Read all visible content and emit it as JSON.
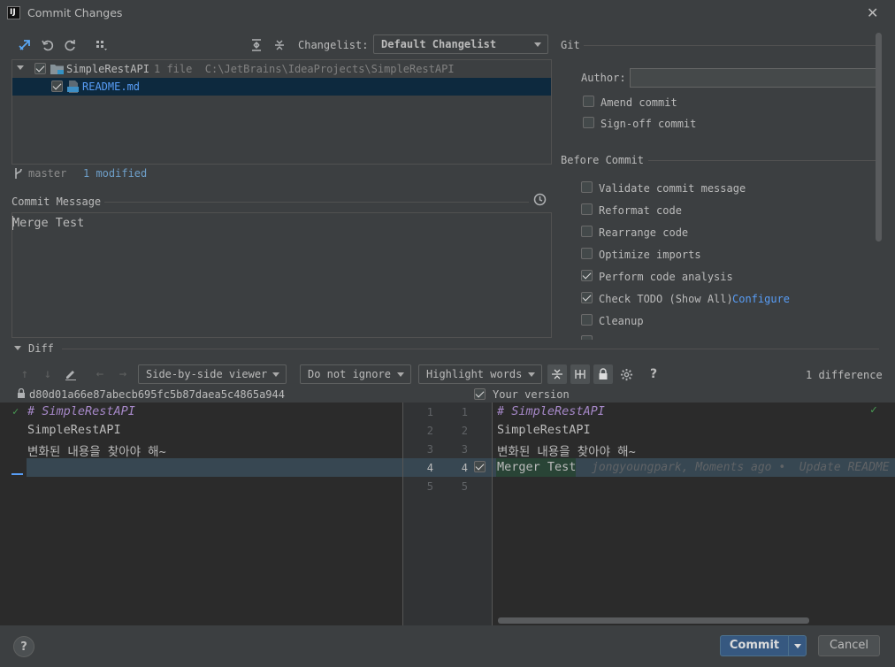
{
  "window": {
    "title": "Commit Changes",
    "close_glyph": "✕"
  },
  "changes_toolbar": {
    "changelist_label": "Changelist:",
    "changelist_value": "Default Changelist"
  },
  "tree": {
    "root_name": "SimpleRestAPI",
    "root_meta": "1 file  C:\\JetBrains\\IdeaProjects\\SimpleRestAPI",
    "file_name": "README.md",
    "file_type_badge": "MD"
  },
  "branch": {
    "name": "master",
    "modified": "1 modified"
  },
  "commit_message": {
    "label": "Commit Message",
    "value": "Merge Test"
  },
  "git": {
    "section_title": "Git",
    "author_label": "Author:",
    "author_value": "",
    "amend_label": "Amend commit",
    "signoff_label": "Sign-off commit"
  },
  "before_commit": {
    "section_title": "Before Commit",
    "items": [
      {
        "label": "Validate commit message",
        "checked": false
      },
      {
        "label": "Reformat code",
        "checked": false
      },
      {
        "label": "Rearrange code",
        "checked": false
      },
      {
        "label": "Optimize imports",
        "checked": false
      },
      {
        "label": "Perform code analysis",
        "checked": true
      },
      {
        "label": "Check TODO (Show All)",
        "checked": true,
        "link": "Configure"
      },
      {
        "label": "Cleanup",
        "checked": false
      }
    ]
  },
  "diff": {
    "section_title": "Diff",
    "viewer_mode": "Side-by-side viewer",
    "ignore_mode": "Do not ignore",
    "highlight_mode": "Highlight words",
    "help": "?",
    "difference_count": "1 difference",
    "left_revision": "d80d01a66e87abecb695fc5b87daea5c4865a944",
    "right_revision": "Your version",
    "left_lines": [
      "# SimpleRestAPI",
      "SimpleRestAPI",
      "변화된 내용을 찾아야 해~",
      ""
    ],
    "right_lines": [
      "# SimpleRestAPI",
      "SimpleRestAPI",
      "변화된 내용을 찾아야 해~",
      "Merger Test"
    ],
    "gutter_left": [
      "1",
      "2",
      "3",
      "4",
      "5"
    ],
    "gutter_right": [
      "1",
      "2",
      "3",
      "4",
      "5"
    ],
    "blame": "jongyoungpark, Moments ago •  Update README"
  },
  "footer": {
    "help": "?",
    "commit_label": "Commit",
    "cancel_label": "Cancel"
  },
  "colors": {
    "background": "#3c3f41",
    "editor_bg": "#2b2b2b",
    "selection": "#0d293e",
    "accent": "#365880",
    "link": "#589df6",
    "changed_line": "#374752",
    "inserted_bg": "#294436"
  }
}
